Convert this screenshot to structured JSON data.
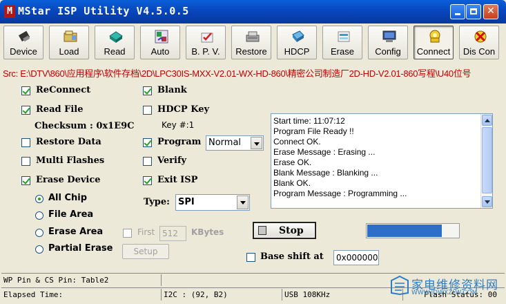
{
  "window": {
    "app_icon": "M",
    "title": "MStar ISP Utility V4.5.0.5"
  },
  "toolbar": [
    {
      "label": "Device",
      "icon": "device-icon"
    },
    {
      "label": "Load",
      "icon": "load-icon"
    },
    {
      "label": "Read",
      "icon": "read-icon"
    },
    {
      "label": "Auto",
      "icon": "auto-icon"
    },
    {
      "label": "B. P. V.",
      "icon": "bpv-icon"
    },
    {
      "label": "Restore",
      "icon": "restore-icon"
    },
    {
      "label": "HDCP",
      "icon": "hdcp-icon"
    },
    {
      "label": "Erase",
      "icon": "erase-icon"
    },
    {
      "label": "Config",
      "icon": "config-icon"
    },
    {
      "label": "Connect",
      "icon": "connect-icon"
    },
    {
      "label": "Dis Con",
      "icon": "disconnect-icon"
    }
  ],
  "source_path": "Src: E:\\DTV\\860\\应用程序\\软件存档\\2D\\LPC30IS-MXX-V2.01-WX-HD-860\\精密公司制造厂2D-HD-V2.01-860写程\\U40位号",
  "options": {
    "reconnect": {
      "label": "ReConnect",
      "checked": true
    },
    "read_file": {
      "label": "Read File",
      "checked": true
    },
    "checksum": "Checksum : 0x1E9C",
    "restore_data": {
      "label": "Restore Data",
      "checked": false
    },
    "multi_flashes": {
      "label": "Multi Flashes",
      "checked": false
    },
    "erase_device": {
      "label": "Erase Device",
      "checked": true
    },
    "blank": {
      "label": "Blank",
      "checked": true
    },
    "hdcp_key": {
      "label": "HDCP Key",
      "checked": false
    },
    "key_number": "Key #:1",
    "program": {
      "label": "Program",
      "checked": true
    },
    "program_mode": "Normal",
    "verify": {
      "label": "Verify",
      "checked": false
    },
    "exit_isp": {
      "label": "Exit ISP",
      "checked": true
    },
    "type_label": "Type:",
    "type_value": "SPI"
  },
  "erase_modes": [
    {
      "label": "All Chip",
      "selected": true
    },
    {
      "label": "File Area",
      "selected": false
    },
    {
      "label": "Erase Area",
      "selected": false
    },
    {
      "label": "Partial Erase",
      "selected": false
    }
  ],
  "first": {
    "label": "First",
    "checked": false,
    "value": "512",
    "unit": "KBytes"
  },
  "setup_label": "Setup",
  "log": [
    "Start time: 11:07:12",
    "Program File Ready !!",
    "Connect OK.",
    "Erase Message : Erasing ...",
    "Erase OK.",
    "Blank Message : Blanking ...",
    "Blank OK.",
    "Program Message : Programming ..."
  ],
  "stop_label": "Stop",
  "progress_fraction": 0.82,
  "base_shift": {
    "label": "Base shift at",
    "checked": false,
    "value": "0x000000"
  },
  "status": {
    "wp_pin": "WP Pin & CS Pin: Table2",
    "elapsed": "Elapsed Time:",
    "i2c": "I2C : (92, B2)",
    "usb": "USB  108KHz",
    "flash_status": "Flash Status: 00"
  },
  "watermark": {
    "text": "家电维修资料网",
    "url": "WWW.JDWXZLW.COM"
  },
  "colors": {
    "title_bar": "#0a5fd8",
    "source_text": "#c00000",
    "check": "#21a121",
    "progress": "#2f6ec8"
  }
}
